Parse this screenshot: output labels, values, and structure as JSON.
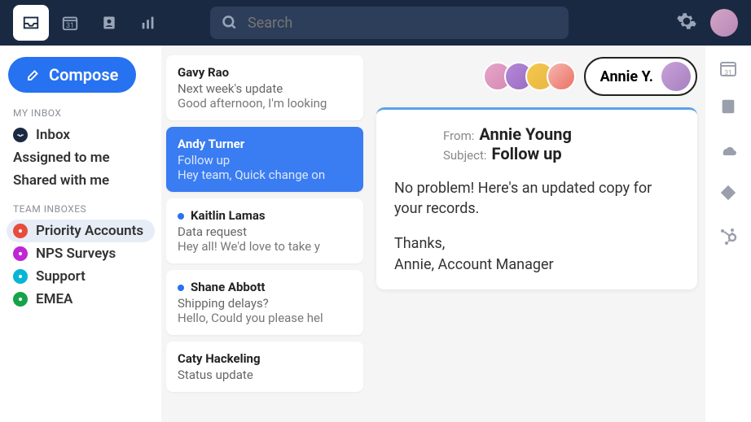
{
  "search": {
    "placeholder": "Search"
  },
  "compose_label": "Compose",
  "sections": {
    "my_inbox_label": "MY INBOX",
    "team_inboxes_label": "TEAM INBOXES"
  },
  "nav_my": [
    {
      "label": "Inbox",
      "icon": "inbox",
      "bold": true
    },
    {
      "label": "Assigned to me",
      "bold": true
    },
    {
      "label": "Shared with me",
      "bold": true
    }
  ],
  "nav_team": [
    {
      "label": "Priority Accounts",
      "color": "#e74c3c",
      "selected": true
    },
    {
      "label": "NPS Surveys",
      "color": "#c026d3"
    },
    {
      "label": "Support",
      "color": "#06b6d4"
    },
    {
      "label": "EMEA",
      "color": "#16a34a"
    }
  ],
  "threads": [
    {
      "name": "Gavy Rao",
      "subject": "Next week's update",
      "preview": "Good afternoon, I'm looking"
    },
    {
      "name": "Andy Turner",
      "subject": "Follow up",
      "preview": "Hey team, Quick change on",
      "selected": true
    },
    {
      "name": "Kaitlin Lamas",
      "subject": "Data request",
      "preview": "Hey all! We'd love to take y",
      "unread": true
    },
    {
      "name": "Shane Abbott",
      "subject": "Shipping delays?",
      "preview": "Hello, Could you please hel",
      "unread": true
    },
    {
      "name": "Caty Hackeling",
      "subject": "Status update",
      "preview": ""
    }
  ],
  "viewer": {
    "pill_name": "Annie Y."
  },
  "message": {
    "from_label": "From:",
    "from": "Annie Young",
    "subject_label": "Subject:",
    "subject": "Follow up",
    "body_p1": "No problem! Here's an updated copy for your records.",
    "body_p2": "Thanks,",
    "body_p3": "Annie, Account Manager"
  }
}
